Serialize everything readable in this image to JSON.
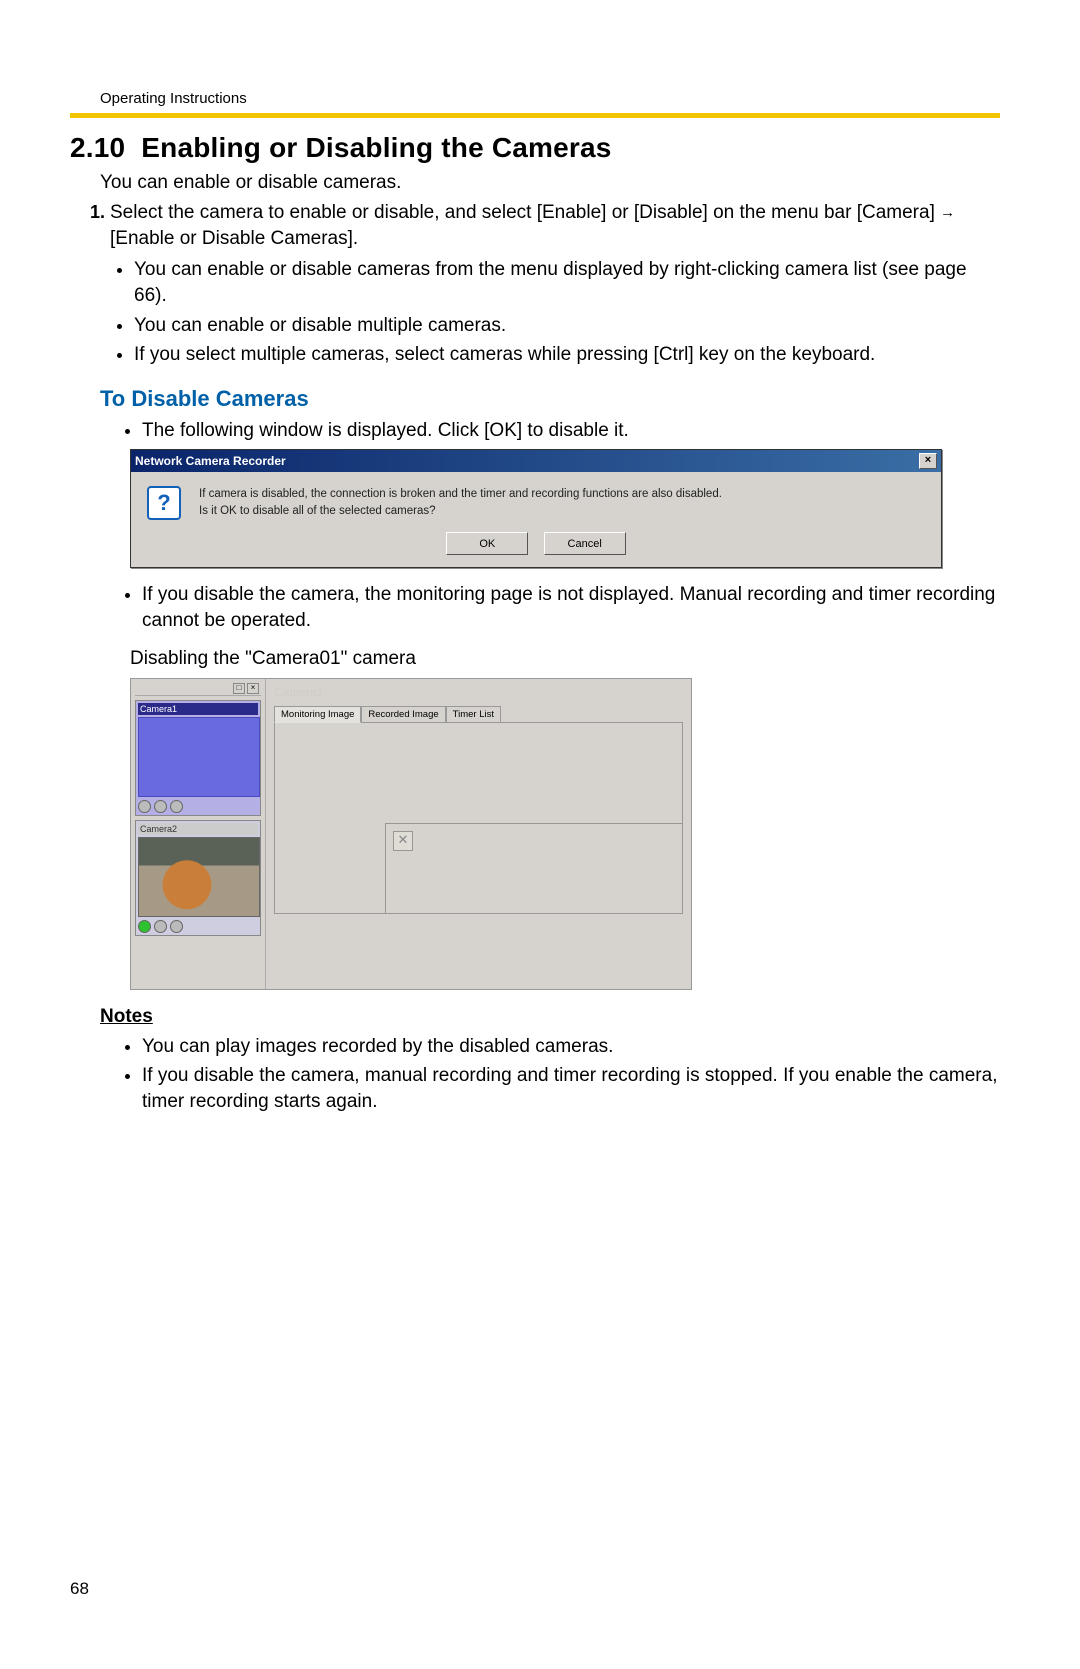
{
  "header": "Operating Instructions",
  "section_number": "2.10",
  "section_title": "Enabling or Disabling the Cameras",
  "intro": "You can enable or disable cameras.",
  "step1_a": "Select the camera to enable or disable, and select [Enable] or [Disable] on the menu bar [Camera]",
  "step1_b": "[Enable or Disable Cameras].",
  "step1_bullets": [
    "You can enable or disable cameras from the menu displayed by right-clicking camera list (see page 66).",
    "You can enable or disable multiple cameras.",
    "If you select multiple cameras, select cameras while pressing [Ctrl] key on the keyboard."
  ],
  "subhead_disable": "To Disable Cameras",
  "disable_bullet1": "The following window is displayed. Click [OK] to disable it.",
  "dialog": {
    "title": "Network Camera Recorder",
    "line1": "If camera is disabled, the connection is broken and the timer and recording functions are also disabled.",
    "line2": "Is it OK to disable all of the selected cameras?",
    "ok": "OK",
    "cancel": "Cancel"
  },
  "disable_bullet2": "If you disable the camera, the monitoring page is not displayed. Manual recording and timer recording cannot be operated.",
  "caption": "Disabling the \"Camera01\" camera",
  "app": {
    "cam1": "Camera1",
    "cam2": "Camera2",
    "ghost": "Camera1",
    "tab1": "Monitoring Image",
    "tab2": "Recorded Image",
    "tab3": "Timer List"
  },
  "notes_heading": "Notes",
  "notes": [
    "You can play images recorded by the disabled cameras.",
    "If you disable the camera, manual recording and timer recording is stopped. If you enable the camera, timer recording starts again."
  ],
  "page_number": "68"
}
